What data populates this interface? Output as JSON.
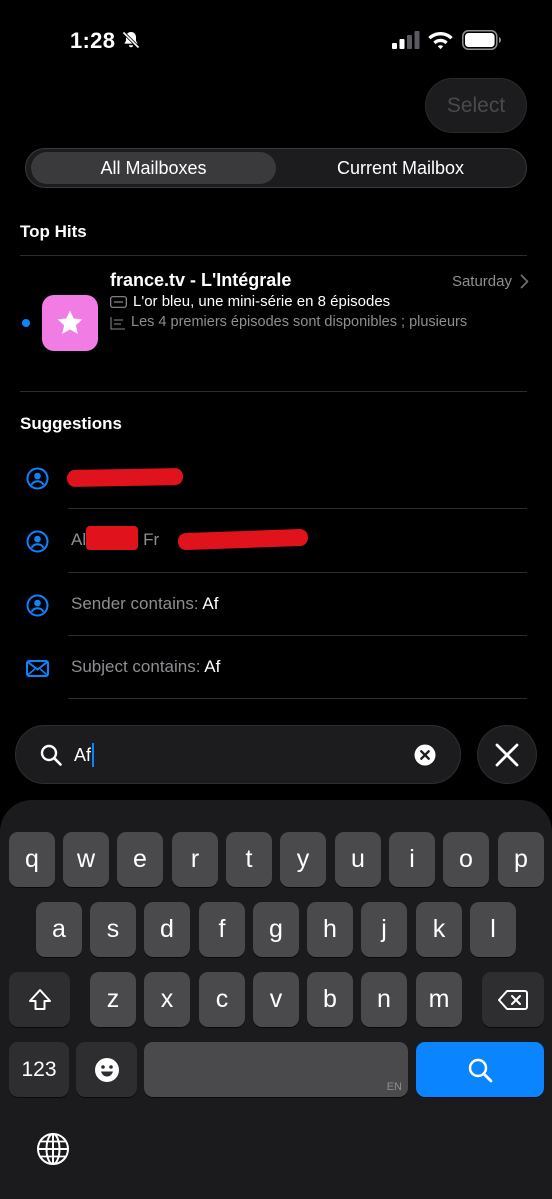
{
  "status_bar": {
    "time": "1:28"
  },
  "header": {
    "select_label": "Select"
  },
  "scope": {
    "all_label": "All Mailboxes",
    "current_label": "Current Mailbox"
  },
  "top_hits": {
    "title": "Top Hits",
    "item": {
      "sender": "france.tv - L'Intégrale",
      "date": "Saturday",
      "subject": "L'or bleu, une mini-série en 8 épisodes",
      "preview": "Les 4 premiers épisodes sont disponibles ; plusieurs",
      "unread": true,
      "icon_color": "#f17ce4"
    }
  },
  "suggestions": {
    "title": "Suggestions",
    "items": [
      {
        "icon": "person-circle-icon",
        "text": ""
      },
      {
        "icon": "person-circle-icon",
        "prefix": "Al",
        "middle": "Fr"
      },
      {
        "icon": "person-circle-icon",
        "label": "Sender contains: ",
        "query": "Af"
      },
      {
        "icon": "envelope-icon",
        "label": "Subject contains: ",
        "query": "Af"
      }
    ]
  },
  "search": {
    "value": "Af"
  },
  "keyboard": {
    "row1": [
      "q",
      "w",
      "e",
      "r",
      "t",
      "y",
      "u",
      "i",
      "o",
      "p"
    ],
    "row2": [
      "a",
      "s",
      "d",
      "f",
      "g",
      "h",
      "j",
      "k",
      "l"
    ],
    "row3": [
      "z",
      "x",
      "c",
      "v",
      "b",
      "n",
      "m"
    ],
    "numbers_label": "123",
    "language": "EN"
  },
  "colors": {
    "accent": "#0a84ff",
    "background": "#000000",
    "redaction": "#e0121b"
  }
}
